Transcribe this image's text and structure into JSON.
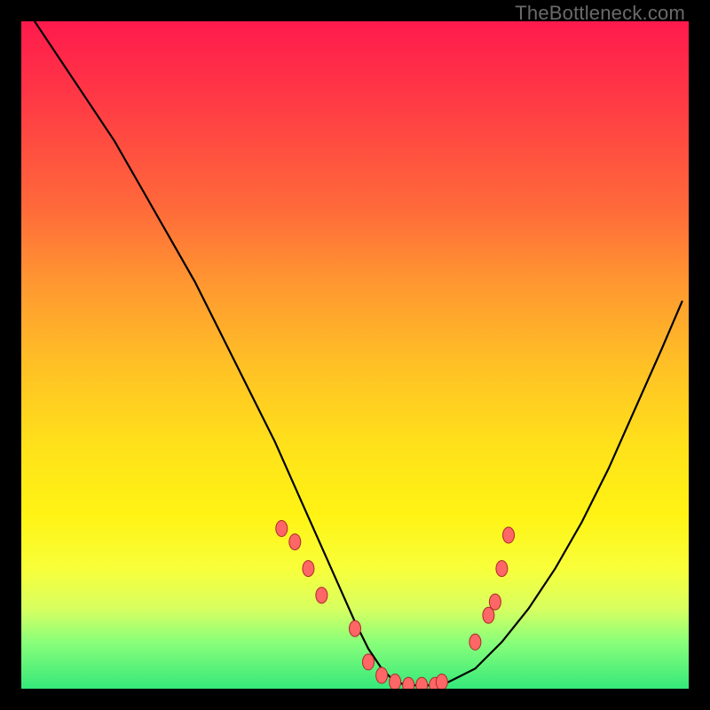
{
  "watermark": "TheBottleneck.com",
  "colors": {
    "curve_stroke": "#000000",
    "dot_fill": "#ff6666",
    "dot_stroke": "#aa2a2a"
  },
  "chart_data": {
    "type": "line",
    "title": "",
    "xlabel": "",
    "ylabel": "",
    "xlim": [
      0,
      100
    ],
    "ylim": [
      0,
      100
    ],
    "series": [
      {
        "name": "bottleneck-curve",
        "x": [
          2,
          6,
          10,
          14,
          18,
          22,
          26,
          30,
          34,
          38,
          42,
          46,
          50,
          52,
          54,
          56,
          58,
          60,
          62,
          64,
          68,
          72,
          76,
          80,
          84,
          88,
          92,
          96,
          99
        ],
        "values": [
          100,
          94,
          88,
          82,
          75,
          68,
          61,
          53,
          45,
          37,
          28,
          19,
          10,
          6,
          3,
          1,
          0.5,
          0.5,
          0.5,
          1,
          3,
          7,
          12,
          18,
          25,
          33,
          42,
          51,
          58
        ]
      }
    ],
    "data_points": {
      "name": "highlighted-range",
      "x": [
        39,
        41,
        43,
        45,
        50,
        52,
        54,
        56,
        58,
        60,
        62,
        63,
        68,
        70,
        71,
        72,
        73
      ],
      "values": [
        24,
        22,
        18,
        14,
        9,
        4,
        2,
        1,
        0.5,
        0.5,
        0.5,
        1,
        7,
        11,
        13,
        18,
        23
      ]
    }
  }
}
